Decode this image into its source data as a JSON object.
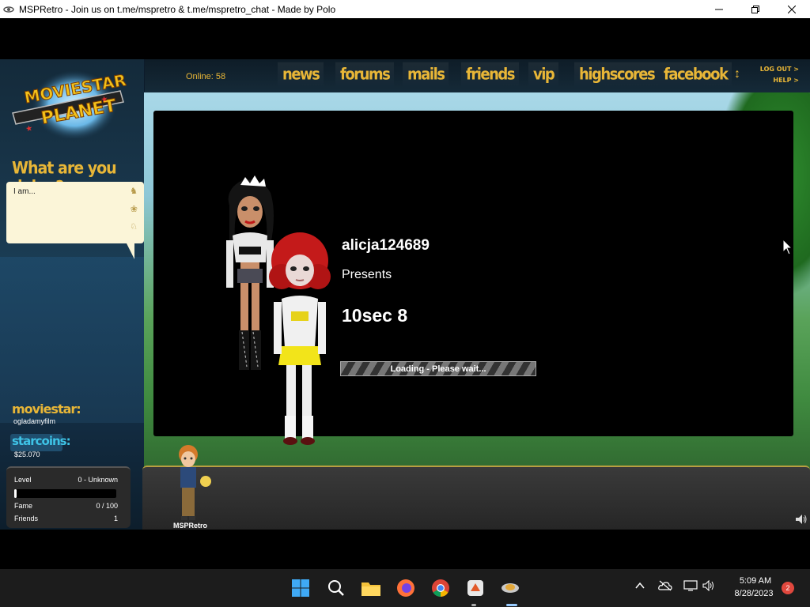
{
  "window": {
    "title": "MSPRetro - Join us on t.me/mspretro & t.me/mspretro_chat - Made by Polo"
  },
  "nav": {
    "online": "Online: 58",
    "items": [
      "news",
      "forums",
      "mails",
      "friends",
      "vip",
      "highscores",
      "facebook"
    ],
    "logout": "LOG OUT >",
    "help": "HELP >"
  },
  "logo": {
    "line1": "MOVIESTAR",
    "line2": "PLANET"
  },
  "status": {
    "title": "What are you doing?",
    "text": "I am..."
  },
  "profile": {
    "moviestar_label": "moviestar:",
    "moviestar_name": "ogladamyfilm",
    "starcoins_label": "starcoins:",
    "starcoins_value": "$25.070"
  },
  "stats": {
    "level_label": "Level",
    "level_value": "0 - Unknown",
    "level_progress": 0.02,
    "fame_label": "Fame",
    "fame_value": "0 / 100",
    "friends_label": "Friends",
    "friends_value": "1"
  },
  "popup": {
    "presenter": "alicja124689",
    "presents": "Presents",
    "movie_title": "10sec 8",
    "loading": "Loading - Please wait..."
  },
  "bottom": {
    "avatar_name": "MSPRetro"
  },
  "taskbar": {
    "time": "5:09 AM",
    "date": "8/28/2023",
    "notifications": "2"
  },
  "colors": {
    "accent_gold": "#e8b637",
    "starcoin_blue": "#3ec3e6",
    "notification_red": "#e0483e"
  }
}
